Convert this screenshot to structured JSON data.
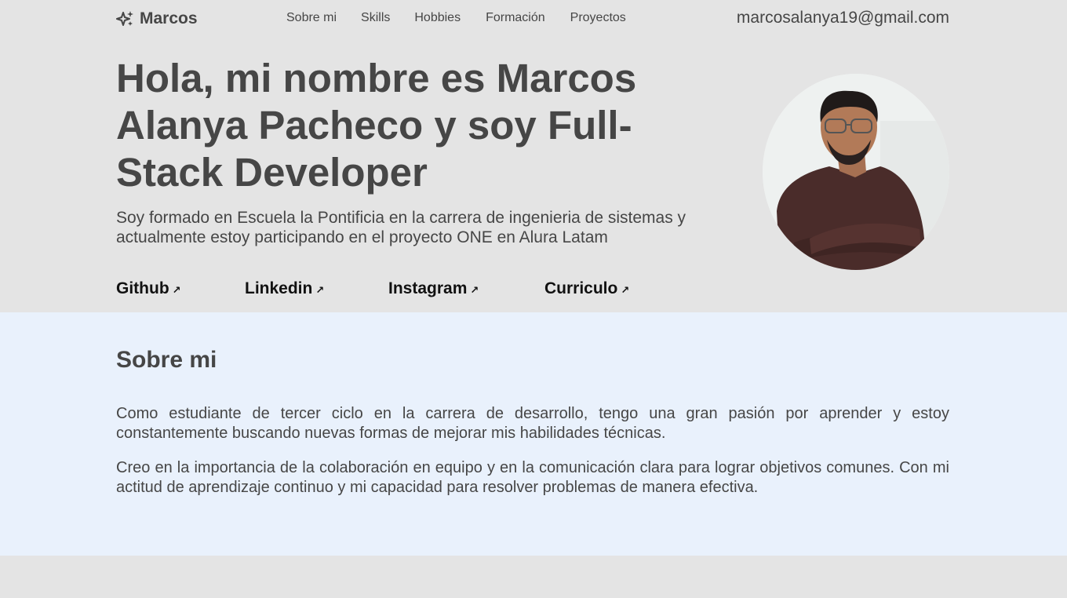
{
  "brand": {
    "icon": "sparkles-icon",
    "name": "Marcos"
  },
  "nav": {
    "items": [
      "Sobre mi",
      "Skills",
      "Hobbies",
      "Formación",
      "Proyectos"
    ]
  },
  "contact": {
    "email": "marcosalanya19@gmail.com"
  },
  "hero": {
    "title": "Hola, mi nombre es Marcos Alanya Pacheco y soy Full-Stack Developer",
    "subtitle": "Soy formado en Escuela la Pontificia en la carrera de ingenieria de sistemas y actualmente estoy participando en el proyecto ONE en Alura Latam",
    "links": [
      {
        "label": "Github",
        "icon": "arrow-up-right-icon"
      },
      {
        "label": "Linkedin",
        "icon": "arrow-up-right-icon"
      },
      {
        "label": "Instagram",
        "icon": "arrow-up-right-icon"
      },
      {
        "label": "Curriculo",
        "icon": "arrow-up-right-icon"
      }
    ]
  },
  "about": {
    "heading": "Sobre mi",
    "paragraphs": [
      "Como estudiante de tercer ciclo en la carrera de desarrollo, tengo una gran pasión por aprender y estoy constantemente buscando nuevas formas de mejorar mis habilidades técnicas.",
      "Creo en la importancia de la colaboración en equipo y en la comunicación clara para lograr objetivos comunes. Con mi actitud de aprendizaje continuo y mi capacidad para resolver problemas de manera efectiva."
    ]
  }
}
